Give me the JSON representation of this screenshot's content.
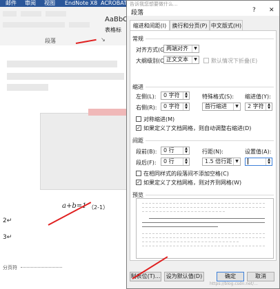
{
  "ribbon": {
    "tabs": [
      "邮件",
      "审阅",
      "视图",
      "EndNote X8",
      "ACROBAT"
    ]
  },
  "toolbar": {
    "style_label": "AaBbCc",
    "table_label": "表格标",
    "group_label": "段落"
  },
  "doc": {
    "formula": "a+b=1",
    "formula_no": "（2-1）",
    "section_break": "分页符"
  },
  "dialog": {
    "title": "段落",
    "search_hint": "告诉我您想要做什么...",
    "help_label": "?",
    "close_label": "✕",
    "tabs": [
      "缩进和间距(I)",
      "换行和分页(P)",
      "中文版式(H)"
    ],
    "general": {
      "heading": "常规",
      "alignment_label": "对齐方式(G):",
      "alignment_value": "两端对齐",
      "outline_label": "大纲级别(O):",
      "outline_value": "正文文本",
      "collapsed_label": "默认情况下折叠(E)"
    },
    "indent": {
      "heading": "缩进",
      "left_label": "左侧(L):",
      "left_value": "0 字符",
      "right_label": "右侧(R):",
      "right_value": "0 字符",
      "special_label": "特殊格式(S):",
      "special_value": "首行缩进",
      "by_label": "缩进值(Y):",
      "by_value": "2 字符",
      "mirror_label": "对称缩进(M)",
      "auto_label": "如果定义了文档网格，则自动调整右缩进(D)"
    },
    "spacing": {
      "heading": "间距",
      "before_label": "段前(B):",
      "before_value": "0 行",
      "after_label": "段后(F):",
      "after_value": "0 行",
      "line_label": "行距(N):",
      "line_value": "1.5 倍行距",
      "at_label": "设置值(A):",
      "same_style_label": "在相同样式的段落间不添加空格(C)",
      "snap_label": "如果定义了文档网格，则对齐到网格(W)"
    },
    "preview": {
      "heading": "预览"
    },
    "buttons": {
      "tabs": "制表位(T)...",
      "default": "设为默认值(D)",
      "ok": "确定",
      "cancel": "取消"
    },
    "watermark": "https://blog.csdn.net/..."
  }
}
